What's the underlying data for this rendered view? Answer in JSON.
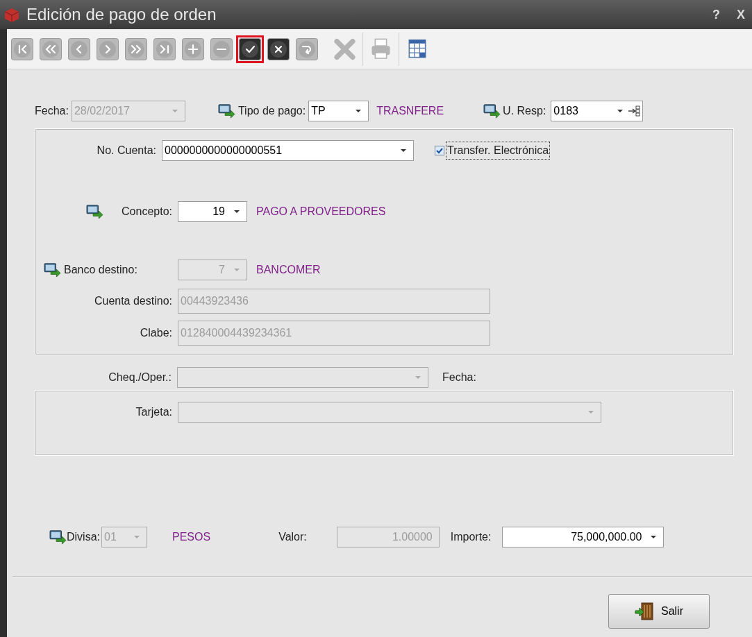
{
  "window": {
    "title": "Edición de pago de orden",
    "help": "?",
    "close": "X"
  },
  "toolbar": [
    {
      "kind": "first",
      "disabled": true,
      "focused": false
    },
    {
      "kind": "prev-page",
      "disabled": true,
      "focused": false
    },
    {
      "kind": "prev",
      "disabled": true,
      "focused": false
    },
    {
      "kind": "next",
      "disabled": true,
      "focused": false
    },
    {
      "kind": "next-page",
      "disabled": true,
      "focused": false
    },
    {
      "kind": "last",
      "disabled": true,
      "focused": false
    },
    {
      "kind": "add",
      "disabled": true,
      "focused": false
    },
    {
      "kind": "remove",
      "disabled": true,
      "focused": false
    },
    {
      "kind": "save",
      "disabled": false,
      "focused": true
    },
    {
      "kind": "cancel",
      "disabled": false,
      "focused": false
    },
    {
      "kind": "refresh",
      "disabled": true,
      "focused": false
    },
    {
      "kind": "delete",
      "disabled": true,
      "focused": false
    },
    {
      "kind": "print",
      "disabled": true,
      "focused": false
    },
    {
      "kind": "grid",
      "disabled": false,
      "focused": false
    }
  ],
  "header": {
    "fecha": {
      "label": "Fecha:",
      "value": "28/02/2017",
      "disabled": true
    },
    "tipo_pago": {
      "label": "Tipo de pago:",
      "value": "TP",
      "description": "TRASNFERE"
    },
    "u_resp": {
      "label": "U. Resp:",
      "value": "0183"
    }
  },
  "account_panel": {
    "no_cuenta": {
      "label": "No. Cuenta:",
      "value": "0000000000000000551"
    },
    "transfer": {
      "label": "Transfer. Electrónica",
      "checked": true,
      "focused": true
    },
    "concepto": {
      "label": "Concepto:",
      "value": "19",
      "description": "PAGO A PROVEEDORES",
      "disabled": false
    },
    "banco_destino": {
      "label": "Banco destino:",
      "value": "7",
      "description": "BANCOMER",
      "disabled": true
    },
    "cuenta_destino": {
      "label": "Cuenta destino:",
      "value": "00443923436",
      "disabled": true
    },
    "clabe": {
      "label": "Clabe:",
      "value": "012840004439234361",
      "disabled": true
    }
  },
  "cheque": {
    "label": "Cheq./Oper.:",
    "disabled": true
  },
  "cheque_fecha": {
    "label": "Fecha:"
  },
  "card_panel": {
    "tarjeta": {
      "label": "Tarjeta:",
      "disabled": true
    }
  },
  "currency": {
    "divisa": {
      "label": "Divisa:",
      "value": "01",
      "description": "PESOS",
      "disabled": true
    },
    "valor": {
      "label": "Valor:",
      "value": "1.00000",
      "disabled": true
    },
    "importe": {
      "label": "Importe:",
      "value": "75,000,000.00",
      "disabled": false
    }
  },
  "exit_button": {
    "label": "Salir"
  }
}
